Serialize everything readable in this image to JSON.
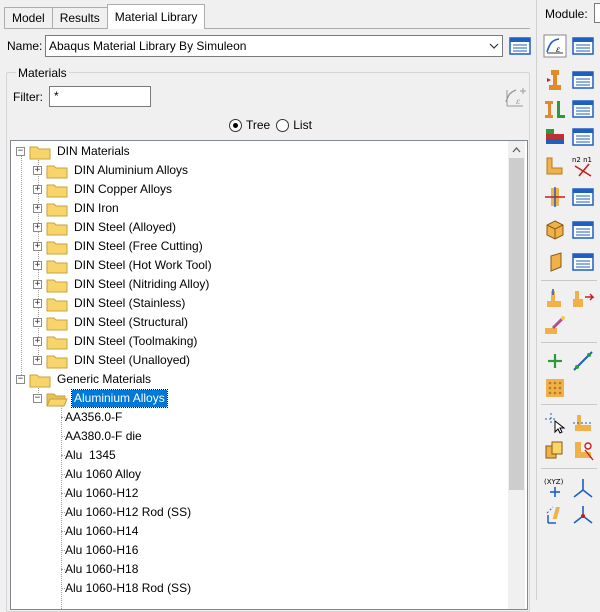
{
  "tabs": [
    "Model",
    "Results",
    "Material Library"
  ],
  "name_label": "Name:",
  "library_name": "Abaqus Material Library By Simuleon",
  "materials_group": "Materials",
  "filter_label": "Filter:",
  "filter_value": "*",
  "view_options": [
    "Tree",
    "List"
  ],
  "view_selected": "Tree",
  "tree": {
    "din_root": "DIN Materials",
    "din_children": [
      "DIN Aluminium Alloys",
      "DIN Copper Alloys",
      "DIN Iron",
      "DIN Steel (Alloyed)",
      "DIN Steel (Free Cutting)",
      "DIN Steel (Hot Work Tool)",
      "DIN Steel (Nitriding Alloy)",
      "DIN Steel (Stainless)",
      "DIN Steel (Structural)",
      "DIN Steel (Toolmaking)",
      "DIN Steel (Unalloyed)"
    ],
    "generic_root": "Generic Materials",
    "aluminium_folder": "Aluminium Alloys",
    "aluminium_items": [
      "AA356.0-F",
      "AA380.0-F die",
      "Alu  1345",
      "Alu 1060 Alloy",
      "Alu 1060-H12",
      "Alu 1060-H12 Rod (SS)",
      "Alu 1060-H14",
      "Alu 1060-H16",
      "Alu 1060-H18",
      "Alu 1060-H18 Rod (SS)"
    ]
  },
  "module_label": "Module:",
  "colors": {
    "selection": "#0078d7",
    "folder": "#f8d56b",
    "accent_blue": "#1f5fbf"
  }
}
